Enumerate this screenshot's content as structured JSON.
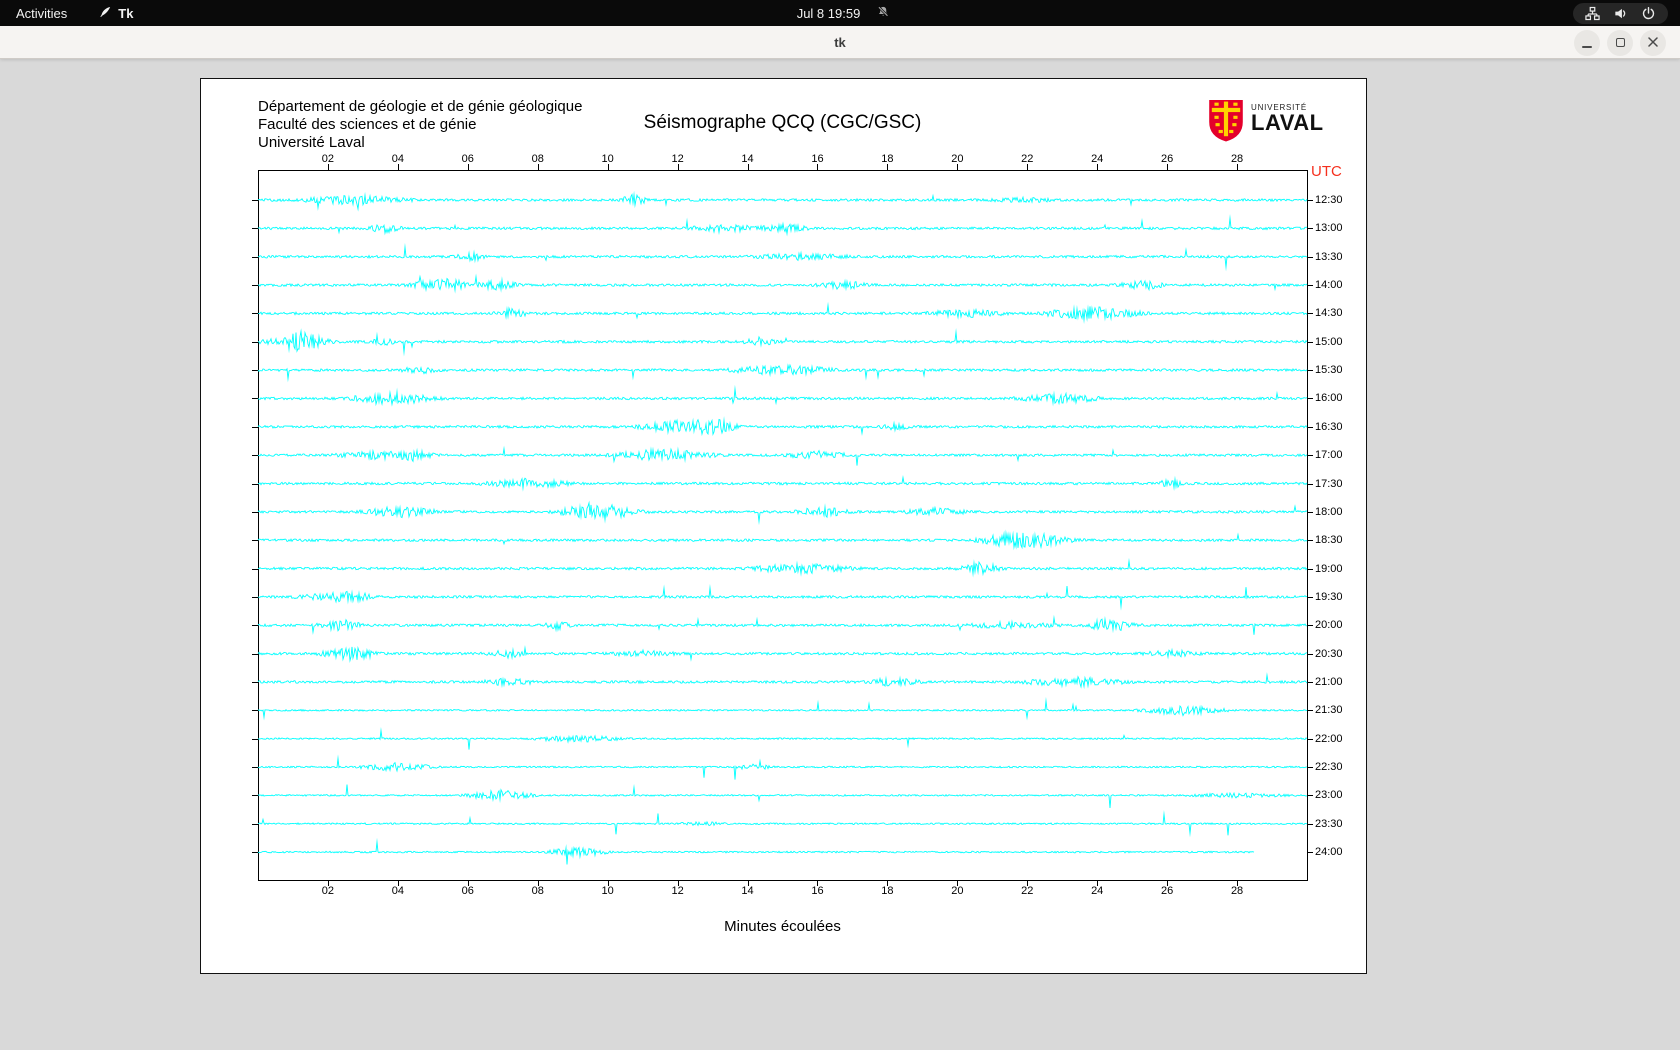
{
  "topbar": {
    "activities_label": "Activities",
    "app_name": "Tk",
    "clock": "Jul 8 19:59"
  },
  "window": {
    "title": "tk"
  },
  "seismograph": {
    "header_lines": [
      "Département de géologie et de génie géologique",
      "Faculté des sciences et de génie",
      "Université Laval"
    ],
    "title": "Séismographe QCQ (CGC/GSC)",
    "utc_label": "UTC",
    "utc_color": "#f5301e",
    "x_axis_label": "Minutes écoulées",
    "x_ticks": [
      "02",
      "04",
      "06",
      "08",
      "10",
      "12",
      "14",
      "16",
      "18",
      "20",
      "22",
      "24",
      "26",
      "28"
    ],
    "rows": [
      "12:30",
      "13:00",
      "13:30",
      "14:00",
      "14:30",
      "15:00",
      "15:30",
      "16:00",
      "16:30",
      "17:00",
      "17:30",
      "18:00",
      "18:30",
      "19:00",
      "19:30",
      "20:00",
      "20:30",
      "21:00",
      "21:30",
      "22:00",
      "22:30",
      "23:00",
      "23:30",
      "24:00"
    ],
    "minutes_per_line": 30,
    "trace_color": "#00ffff",
    "last_row_fraction": 0.95,
    "logo": {
      "top": "UNIVERSITÉ",
      "name": "LAVAL",
      "shield_red": "#e4002b",
      "shield_gold": "#ffd200"
    }
  }
}
